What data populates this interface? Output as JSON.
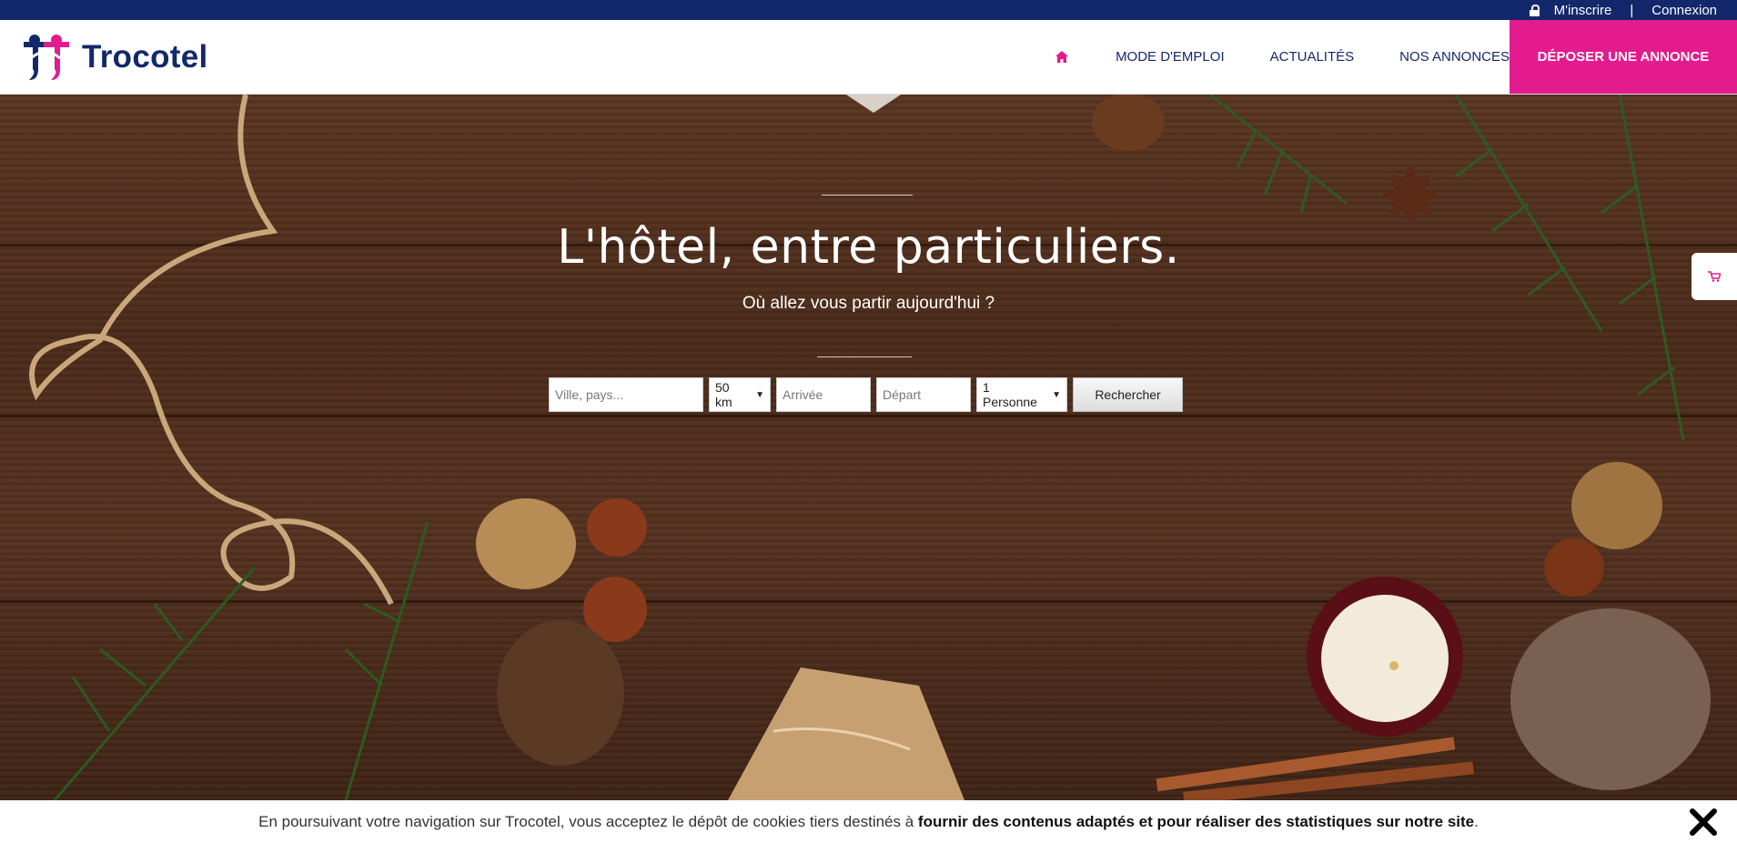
{
  "topbar": {
    "register": "M'inscrire",
    "separator": "|",
    "login": "Connexion"
  },
  "header": {
    "brand": "Trocotel",
    "nav": {
      "mode_emploi": "MODE D'EMPLOI",
      "actualites": "ACTUALITÉS",
      "annonces": "NOS ANNONCES"
    },
    "cta": "DÉPOSER UNE ANNONCE"
  },
  "hero": {
    "title": "L'hôtel, entre particuliers.",
    "subtitle": "Où allez vous partir aujourd'hui ?"
  },
  "search": {
    "destination_placeholder": "Ville, pays...",
    "radius": "50 km",
    "arrival_placeholder": "Arrivée",
    "departure_placeholder": "Départ",
    "guests": "1 Personne",
    "button": "Rechercher"
  },
  "cookie": {
    "text_start": "En poursuivant votre navigation sur Trocotel, vous acceptez le dépôt de cookies tiers destinés à ",
    "text_bold": "fournir des contenus adaptés et pour réaliser des statistiques sur notre site",
    "text_end": "."
  },
  "colors": {
    "navy": "#13286b",
    "pink": "#e31b8d"
  }
}
